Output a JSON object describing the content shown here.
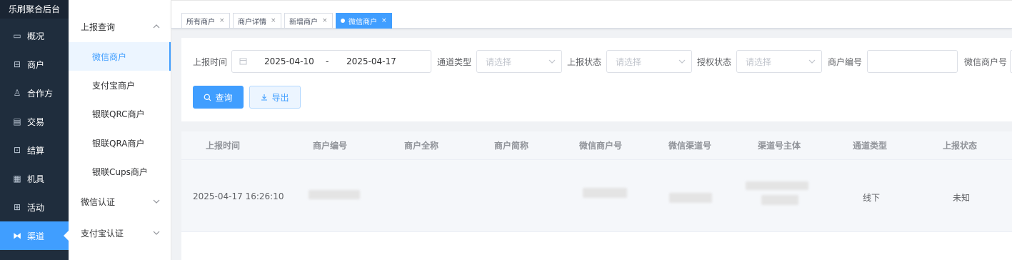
{
  "app": {
    "title": "乐刷聚合后台"
  },
  "nav": [
    {
      "label": "概况",
      "icon": "overview-icon",
      "glyph": "▭"
    },
    {
      "label": "商户",
      "icon": "merchant-icon",
      "glyph": "⊟"
    },
    {
      "label": "合作方",
      "icon": "partner-icon",
      "glyph": "♙"
    },
    {
      "label": "交易",
      "icon": "transaction-icon",
      "glyph": "▤"
    },
    {
      "label": "结算",
      "icon": "settlement-icon",
      "glyph": "⊡"
    },
    {
      "label": "机具",
      "icon": "device-icon",
      "glyph": "▦"
    },
    {
      "label": "活动",
      "icon": "activity-icon",
      "glyph": "⊞"
    },
    {
      "label": "渠道",
      "icon": "channel-icon",
      "glyph": "⧓",
      "active": true
    }
  ],
  "submenu": {
    "group1": "上报查询",
    "items": [
      "微信商户",
      "支付宝商户",
      "银联QRC商户",
      "银联QRA商户",
      "银联Cups商户"
    ],
    "group2": "微信认证",
    "group3": "支付宝认证"
  },
  "tabs": [
    {
      "label": "所有商户"
    },
    {
      "label": "商户详情"
    },
    {
      "label": "新增商户"
    },
    {
      "label": "微信商户",
      "active": true
    }
  ],
  "filters": {
    "report_time_label": "上报时间",
    "date_start": "2025-04-10",
    "date_sep": "-",
    "date_end": "2025-04-17",
    "channel_type_label": "通道类型",
    "channel_type_placeholder": "请选择",
    "report_status_label": "上报状态",
    "report_status_placeholder": "请选择",
    "auth_status_label": "授权状态",
    "auth_status_placeholder": "请选择",
    "merchant_no_label": "商户编号",
    "merchant_no_value": "",
    "wx_merchant_no_label": "微信商户号"
  },
  "buttons": {
    "query": "查询",
    "export": "导出"
  },
  "table": {
    "headers": [
      "上报时间",
      "商户编号",
      "商户全称",
      "商户简称",
      "微信商户号",
      "微信渠道号",
      "渠道号主体",
      "通道类型",
      "上报状态"
    ],
    "rows": [
      {
        "report_time": "2025-04-17 16:26:10",
        "merchant_no": "",
        "full_name": "",
        "short_name": "",
        "wx_merchant_no": "",
        "wx_channel_no": "",
        "channel_subject": "",
        "channel_type": "线下",
        "report_status": "未知"
      }
    ]
  },
  "colors": {
    "nav_bg": "#1f2d3d",
    "accent": "#409eff"
  }
}
